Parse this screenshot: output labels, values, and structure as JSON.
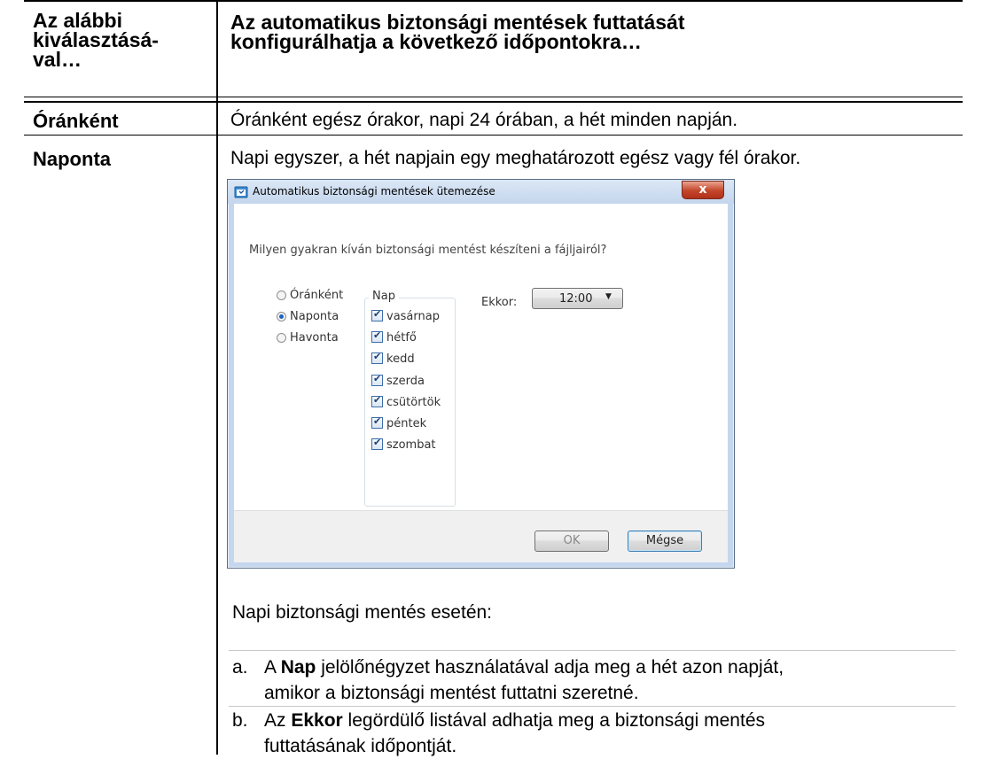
{
  "table": {
    "header_left": [
      "Az alábbi",
      "kiválasztásá-",
      "val…"
    ],
    "header_right": [
      "Az automatikus biztonsági mentések futtatását",
      "konfigurálhatja a következő időpontokra…"
    ],
    "rows": [
      {
        "label": "Óránként",
        "text": "Óránként egész órakor, napi 24 órában, a hét minden napján."
      },
      {
        "label": "Naponta",
        "text": "Napi egyszer, a hét napjain egy meghatározott egész vagy fél órakor."
      }
    ]
  },
  "dialog": {
    "title": "Automatikus biztonsági mentések ütemezése",
    "close_label": "x",
    "question": "Milyen gyakran kíván biztonsági mentést készíteni a fájljairól?",
    "frequency_options": [
      {
        "label": "Óránként",
        "selected": false
      },
      {
        "label": "Naponta",
        "selected": true
      },
      {
        "label": "Havonta",
        "selected": false
      }
    ],
    "day_group_label": "Nap",
    "days": [
      {
        "label": "vasárnap",
        "checked": true
      },
      {
        "label": "hétfő",
        "checked": true
      },
      {
        "label": "kedd",
        "checked": true
      },
      {
        "label": "szerda",
        "checked": true
      },
      {
        "label": "csütörtök",
        "checked": true
      },
      {
        "label": "péntek",
        "checked": true
      },
      {
        "label": "szombat",
        "checked": true
      }
    ],
    "time_label": "Ekkor:",
    "time_value": "12:00",
    "ok_label": "OK",
    "cancel_label": "Mégse",
    "accent_color": "#1b63c6"
  },
  "instructions": {
    "intro": "Napi biztonsági mentés esetén:",
    "items": [
      {
        "marker": "a.",
        "parts": [
          "A ",
          "Nap",
          " jelölőnégyzet használatával adja meg a hét azon napját,"
        ],
        "line2": "amikor a biztonsági mentést futtatni szeretné."
      },
      {
        "marker": "b.",
        "parts": [
          "Az ",
          "Ekkor",
          " legördülő listával adhatja meg a biztonsági mentés"
        ],
        "line2": "futtatásának időpontját."
      }
    ]
  }
}
